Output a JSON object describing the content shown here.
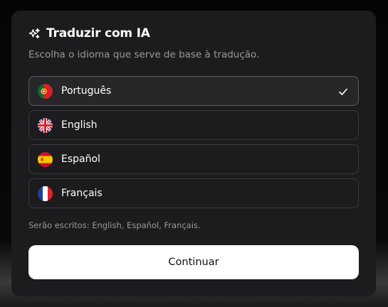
{
  "dialog": {
    "title": "Traduzir com IA",
    "subtitle": "Escolha o idioma que serve de base à tradução.",
    "icon": "sparkles-icon"
  },
  "languages": [
    {
      "label": "Português",
      "flag": "portugal-flag-icon",
      "selected": true
    },
    {
      "label": "English",
      "flag": "uk-flag-icon",
      "selected": false
    },
    {
      "label": "Español",
      "flag": "spain-flag-icon",
      "selected": false
    },
    {
      "label": "Français",
      "flag": "france-flag-icon",
      "selected": false
    }
  ],
  "note": "Serão escritos: English, Español, Français.",
  "continue_label": "Continuar",
  "colors": {
    "modal_bg": "#1c1c1e",
    "button_bg": "#ffffff",
    "muted_text": "#9a9a9e"
  }
}
